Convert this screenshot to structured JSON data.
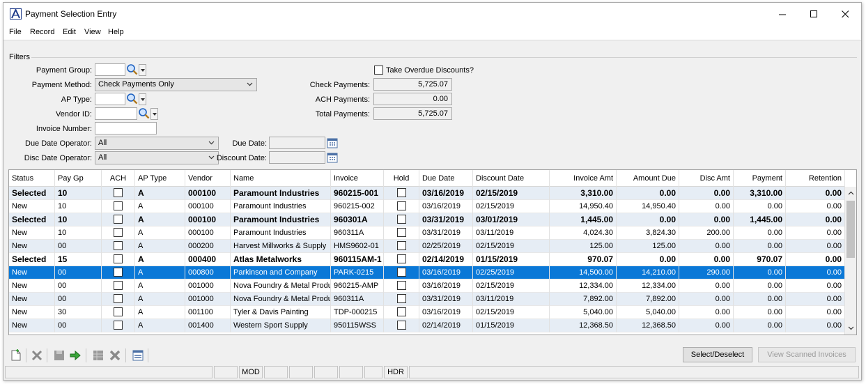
{
  "window": {
    "title": "Payment Selection Entry",
    "accent": "#0a78d7"
  },
  "menu": [
    "File",
    "Record",
    "Edit",
    "View",
    "Help"
  ],
  "filters": {
    "section_label": "Filters",
    "payment_group_label": "Payment Group:",
    "payment_group_value": "",
    "payment_method_label": "Payment Method:",
    "payment_method_value": "Check Payments Only",
    "ap_type_label": "AP Type:",
    "ap_type_value": "",
    "vendor_id_label": "Vendor ID:",
    "vendor_id_value": "",
    "invoice_number_label": "Invoice Number:",
    "invoice_number_value": "",
    "due_date_operator_label": "Due Date Operator:",
    "due_date_operator_value": "All",
    "disc_date_operator_label": "Disc Date Operator:",
    "disc_date_operator_value": "All",
    "due_date_label": "Due Date:",
    "due_date_value": "",
    "discount_date_label": "Discount Date:",
    "discount_date_value": "",
    "take_overdue_label": "Take Overdue Discounts?",
    "check_payments_label": "Check Payments:",
    "check_payments_value": "5,725.07",
    "ach_payments_label": "ACH Payments:",
    "ach_payments_value": "0.00",
    "total_payments_label": "Total Payments:",
    "total_payments_value": "5,725.07"
  },
  "grid": {
    "columns": [
      "Status",
      "Pay Gp",
      "ACH",
      "AP Type",
      "Vendor",
      "Name",
      "Invoice",
      "Hold",
      "Due Date",
      "Discount Date",
      "Invoice Amt",
      "Amount Due",
      "Disc Amt",
      "Payment",
      "Retention"
    ],
    "rows": [
      {
        "status": "Selected",
        "pay_gp": "10",
        "ap_type": "A",
        "vendor": "000100",
        "name": "Paramount Industries",
        "invoice": "960215-001",
        "due_date": "03/16/2019",
        "discount_date": "02/15/2019",
        "invoice_amt": "3,310.00",
        "amount_due": "0.00",
        "disc_amt": "0.00",
        "payment": "3,310.00",
        "retention": "0.00",
        "bold": true,
        "selected": false
      },
      {
        "status": "New",
        "pay_gp": "10",
        "ap_type": "A",
        "vendor": "000100",
        "name": "Paramount Industries",
        "invoice": "960215-002",
        "due_date": "03/16/2019",
        "discount_date": "02/15/2019",
        "invoice_amt": "14,950.40",
        "amount_due": "14,950.40",
        "disc_amt": "0.00",
        "payment": "0.00",
        "retention": "0.00",
        "bold": false,
        "selected": false
      },
      {
        "status": "Selected",
        "pay_gp": "10",
        "ap_type": "A",
        "vendor": "000100",
        "name": "Paramount Industries",
        "invoice": "960301A",
        "due_date": "03/31/2019",
        "discount_date": "03/01/2019",
        "invoice_amt": "1,445.00",
        "amount_due": "0.00",
        "disc_amt": "0.00",
        "payment": "1,445.00",
        "retention": "0.00",
        "bold": true,
        "selected": false
      },
      {
        "status": "New",
        "pay_gp": "10",
        "ap_type": "A",
        "vendor": "000100",
        "name": "Paramount Industries",
        "invoice": "960311A",
        "due_date": "03/31/2019",
        "discount_date": "03/11/2019",
        "invoice_amt": "4,024.30",
        "amount_due": "3,824.30",
        "disc_amt": "200.00",
        "payment": "0.00",
        "retention": "0.00",
        "bold": false,
        "selected": false
      },
      {
        "status": "New",
        "pay_gp": "00",
        "ap_type": "A",
        "vendor": "000200",
        "name": "Harvest Millworks & Supply",
        "invoice": "HMS9602-01",
        "due_date": "02/25/2019",
        "discount_date": "02/15/2019",
        "invoice_amt": "125.00",
        "amount_due": "125.00",
        "disc_amt": "0.00",
        "payment": "0.00",
        "retention": "0.00",
        "bold": false,
        "selected": false
      },
      {
        "status": "Selected",
        "pay_gp": "15",
        "ap_type": "A",
        "vendor": "000400",
        "name": "Atlas Metalworks",
        "invoice": "960115AM-1",
        "due_date": "02/14/2019",
        "discount_date": "01/15/2019",
        "invoice_amt": "970.07",
        "amount_due": "0.00",
        "disc_amt": "0.00",
        "payment": "970.07",
        "retention": "0.00",
        "bold": true,
        "selected": false
      },
      {
        "status": "New",
        "pay_gp": "00",
        "ap_type": "A",
        "vendor": "000800",
        "name": "Parkinson and Company",
        "invoice": "PARK-0215",
        "due_date": "03/16/2019",
        "discount_date": "02/25/2019",
        "invoice_amt": "14,500.00",
        "amount_due": "14,210.00",
        "disc_amt": "290.00",
        "payment": "0.00",
        "retention": "0.00",
        "bold": false,
        "selected": true
      },
      {
        "status": "New",
        "pay_gp": "00",
        "ap_type": "A",
        "vendor": "001000",
        "name": "Nova Foundry & Metal Products",
        "invoice": "960215-AMP",
        "due_date": "03/16/2019",
        "discount_date": "02/15/2019",
        "invoice_amt": "12,334.00",
        "amount_due": "12,334.00",
        "disc_amt": "0.00",
        "payment": "0.00",
        "retention": "0.00",
        "bold": false,
        "selected": false
      },
      {
        "status": "New",
        "pay_gp": "00",
        "ap_type": "A",
        "vendor": "001000",
        "name": "Nova Foundry & Metal Products",
        "invoice": "960311A",
        "due_date": "03/31/2019",
        "discount_date": "03/11/2019",
        "invoice_amt": "7,892.00",
        "amount_due": "7,892.00",
        "disc_amt": "0.00",
        "payment": "0.00",
        "retention": "0.00",
        "bold": false,
        "selected": false
      },
      {
        "status": "New",
        "pay_gp": "30",
        "ap_type": "A",
        "vendor": "001100",
        "name": "Tyler & Davis Painting",
        "invoice": "TDP-000215",
        "due_date": "03/16/2019",
        "discount_date": "02/15/2019",
        "invoice_amt": "5,040.00",
        "amount_due": "5,040.00",
        "disc_amt": "0.00",
        "payment": "0.00",
        "retention": "0.00",
        "bold": false,
        "selected": false
      },
      {
        "status": "New",
        "pay_gp": "00",
        "ap_type": "A",
        "vendor": "001400",
        "name": "Western Sport Supply",
        "invoice": "950115WSS",
        "due_date": "02/14/2019",
        "discount_date": "01/15/2019",
        "invoice_amt": "12,368.50",
        "amount_due": "12,368.50",
        "disc_amt": "0.00",
        "payment": "0.00",
        "retention": "0.00",
        "bold": false,
        "selected": false
      }
    ]
  },
  "toolbar": {
    "icons": [
      "new-record-icon",
      "delete-icon",
      "save-icon",
      "go-arrow-icon",
      "grid-icon",
      "puzzle-icon",
      "list-icon"
    ],
    "select_deselect_label": "Select/Deselect",
    "view_scanned_label": "View Scanned Invoices"
  },
  "statusbar": {
    "mod": "MOD",
    "hdr": "HDR"
  }
}
